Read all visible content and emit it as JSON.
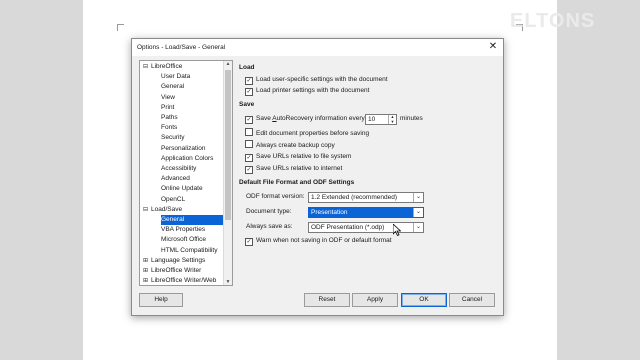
{
  "watermark": "ELTONS",
  "dialog": {
    "title": "Options - Load/Save - General",
    "close_glyph": "✕"
  },
  "tree": {
    "items": [
      {
        "label": "LibreOffice",
        "expander": "⊟"
      },
      {
        "label": "User Data"
      },
      {
        "label": "General"
      },
      {
        "label": "View"
      },
      {
        "label": "Print"
      },
      {
        "label": "Paths"
      },
      {
        "label": "Fonts"
      },
      {
        "label": "Security"
      },
      {
        "label": "Personalization"
      },
      {
        "label": "Application Colors"
      },
      {
        "label": "Accessibility"
      },
      {
        "label": "Advanced"
      },
      {
        "label": "Online Update"
      },
      {
        "label": "OpenCL"
      },
      {
        "label": "Load/Save",
        "expander": "⊟"
      },
      {
        "label": "General",
        "selected": true
      },
      {
        "label": "VBA Properties"
      },
      {
        "label": "Microsoft Office"
      },
      {
        "label": "HTML Compatibility"
      },
      {
        "label": "Language Settings",
        "expander": "⊞"
      },
      {
        "label": "LibreOffice Writer",
        "expander": "⊞"
      },
      {
        "label": "LibreOffice Writer/Web",
        "expander": "⊞"
      }
    ]
  },
  "load": {
    "title": "Load",
    "user_settings": {
      "label": "Load user-specific settings with the document",
      "checked": true
    },
    "printer_settings": {
      "label": "Load printer settings with the document",
      "checked": true
    }
  },
  "save": {
    "title": "Save",
    "autorecovery": {
      "label_pre": "Save ",
      "label_u": "A",
      "label_post": "utoRecovery information every:",
      "checked": true,
      "value": "10",
      "unit": "minutes"
    },
    "edit_props": {
      "label": "Edit document properties before saving",
      "checked": false
    },
    "backup": {
      "label": "Always create backup copy",
      "checked": false
    },
    "rel_fs": {
      "label": "Save URLs relative to file system",
      "checked": true
    },
    "rel_internet": {
      "label": "Save URLs relative to internet",
      "checked": true
    }
  },
  "defaults": {
    "title": "Default File Format and ODF Settings",
    "odf_version": {
      "label": "ODF format version:",
      "value": "1.2 Extended (recommended)"
    },
    "doc_type": {
      "label": "Document type:",
      "value": "Presentation"
    },
    "save_as": {
      "label": "Always save as:",
      "value": "ODF Presentation (*.odp)"
    },
    "warn": {
      "label": "Warn when not saving in ODF or default format",
      "checked": true
    }
  },
  "buttons": {
    "help": "Help",
    "reset": "Reset",
    "apply": "Apply",
    "ok": "OK",
    "cancel": "Cancel"
  },
  "colors": {
    "selection": "#0a64d6",
    "dialog_bg": "#f0f0f0"
  }
}
